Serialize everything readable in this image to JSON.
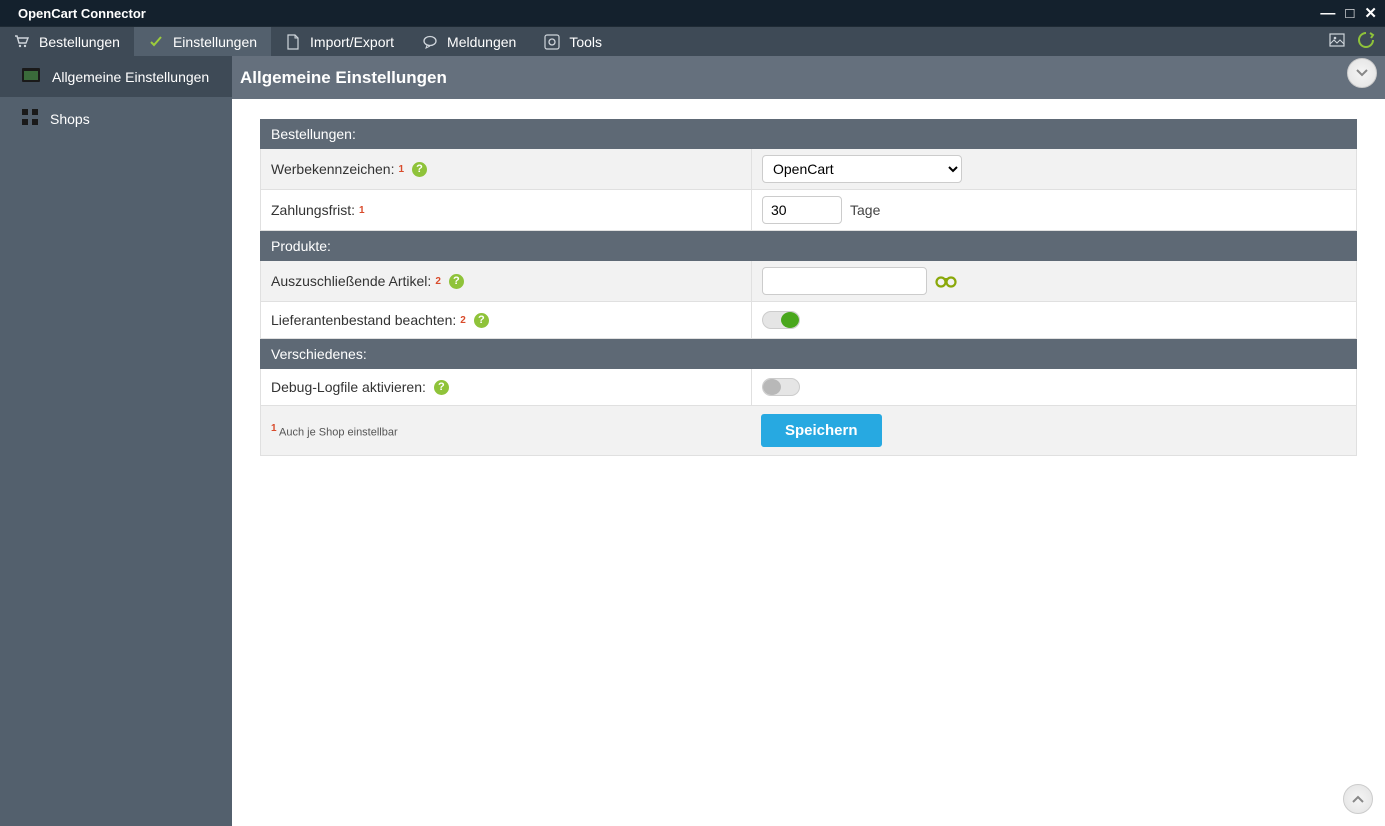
{
  "window": {
    "title": "OpenCart Connector"
  },
  "menubar": {
    "items": [
      {
        "label": "Bestellungen"
      },
      {
        "label": "Einstellungen"
      },
      {
        "label": "Import/Export"
      },
      {
        "label": "Meldungen"
      },
      {
        "label": "Tools"
      }
    ]
  },
  "sidebar": {
    "items": [
      {
        "label": "Allgemeine Einstellungen"
      },
      {
        "label": "Shops"
      }
    ]
  },
  "page": {
    "title": "Allgemeine Einstellungen"
  },
  "sections": {
    "orders": {
      "heading": "Bestellungen:",
      "adcode": {
        "label": "Werbekennzeichen:",
        "value": "OpenCart"
      },
      "paymentdue": {
        "label": "Zahlungsfrist:",
        "value": "30",
        "unit": "Tage"
      }
    },
    "products": {
      "heading": "Produkte:",
      "exclude": {
        "label": "Auszuschließende Artikel:",
        "value": ""
      },
      "supplierstock": {
        "label": "Lieferantenbestand beachten:",
        "on": true
      }
    },
    "misc": {
      "heading": "Verschiedenes:",
      "debug": {
        "label": "Debug-Logfile aktivieren:",
        "on": false
      }
    }
  },
  "footer": {
    "note1": "Auch je Shop einstellbar",
    "save": "Speichern"
  }
}
